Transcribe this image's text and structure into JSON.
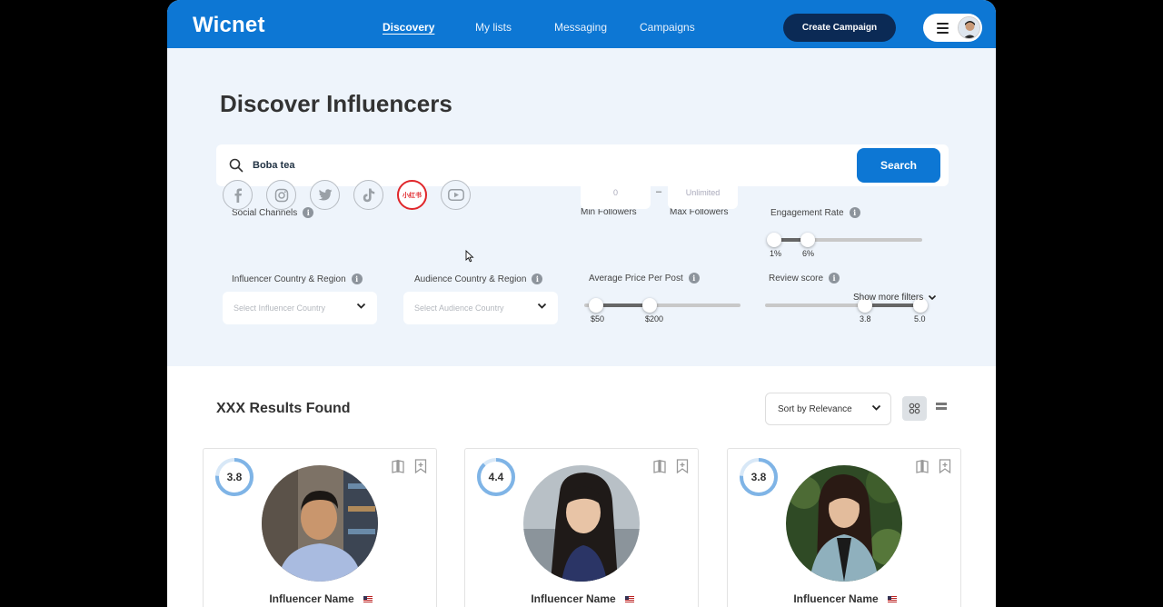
{
  "header": {
    "logo": "Wicnet",
    "nav": [
      {
        "label": "Discovery",
        "active": true
      },
      {
        "label": "My lists",
        "active": false
      },
      {
        "label": "Messaging",
        "active": false
      },
      {
        "label": "Campaigns",
        "active": false
      }
    ],
    "create_button": "Create Campaign",
    "accent_color": "#0d77d4",
    "dark_color": "#0b2a55"
  },
  "page": {
    "title": "Discover Influencers",
    "search": {
      "value": "Boba tea",
      "button": "Search"
    }
  },
  "filters": {
    "social_channels": {
      "label": "Social Channels",
      "channels": [
        {
          "icon": "facebook-icon",
          "selected": false
        },
        {
          "icon": "instagram-icon",
          "selected": false
        },
        {
          "icon": "twitter-icon",
          "selected": false
        },
        {
          "icon": "tiktok-icon",
          "selected": false
        },
        {
          "icon": "xiaohongshu-icon",
          "text": "小红书",
          "selected": true
        },
        {
          "icon": "youtube-icon",
          "selected": false
        }
      ]
    },
    "min_followers": {
      "label": "Min Followers",
      "value": "0"
    },
    "max_followers": {
      "label": "Max Followers",
      "value": "Unlimited"
    },
    "range_dash": "–",
    "engagement_rate": {
      "label": "Engagement Rate",
      "min": "1%",
      "max": "6%",
      "min_value": 1,
      "max_value": 6
    },
    "influencer_country": {
      "label": "Influencer Country & Region",
      "placeholder": "Select Influencer Country"
    },
    "audience_country": {
      "label": "Audience Country & Region",
      "placeholder": "Select Audience Country"
    },
    "price_per_post": {
      "label": "Average Price Per Post",
      "min": "$50",
      "max": "$200",
      "min_value": 50,
      "max_value": 200
    },
    "review_score": {
      "label": "Review score",
      "min": "3.8",
      "max": "5.0",
      "min_value": 3.8,
      "max_value": 5.0
    },
    "show_more": "Show more filters"
  },
  "results": {
    "title": "XXX Results Found",
    "sort": "Sort by Relevance",
    "cards": [
      {
        "score": "3.8",
        "score_value": 3.8,
        "name": "Influencer Name"
      },
      {
        "score": "4.4",
        "score_value": 4.4,
        "name": "Influencer Name"
      },
      {
        "score": "3.8",
        "score_value": 3.8,
        "name": "Influencer Name"
      }
    ]
  }
}
